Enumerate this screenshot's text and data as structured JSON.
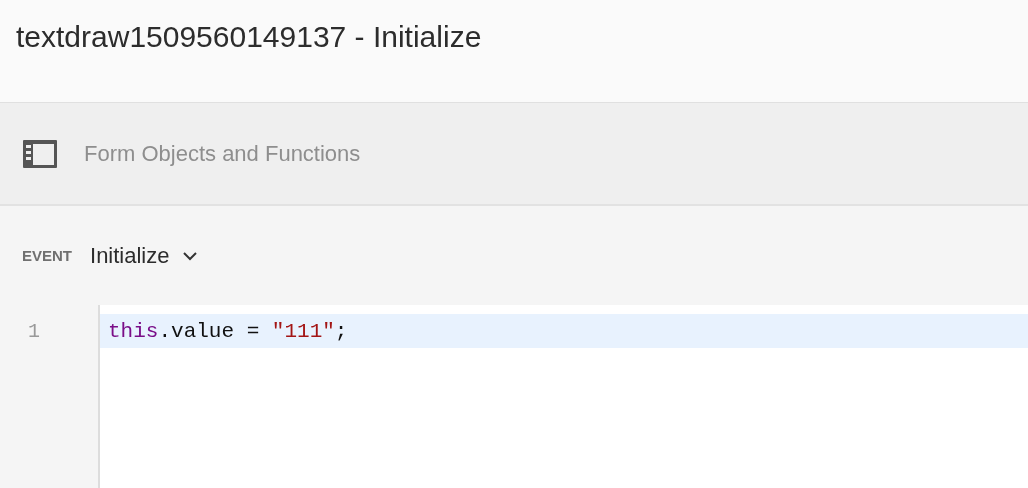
{
  "window": {
    "title": "textdraw1509560149137 - Initialize"
  },
  "panel": {
    "label": "Form Objects and Functions"
  },
  "event": {
    "label": "EVENT",
    "value": "Initialize"
  },
  "editor": {
    "lines": [
      {
        "number": "1",
        "active": true,
        "tokens": [
          {
            "kind": "keyword",
            "text": "this"
          },
          {
            "kind": "plain",
            "text": ".value = "
          },
          {
            "kind": "string",
            "text": "\"111\""
          },
          {
            "kind": "plain",
            "text": ";"
          }
        ]
      }
    ]
  }
}
